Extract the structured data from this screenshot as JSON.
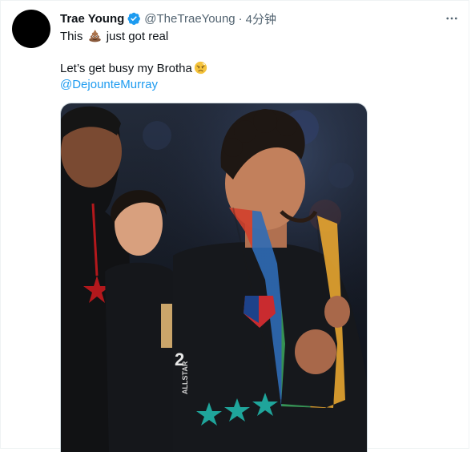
{
  "tweet": {
    "author_name": "Trae Young",
    "author_handle": "@TheTraeYoung",
    "separator": "·",
    "time": "4分钟",
    "line1_before": "This",
    "line1_after": "just got real",
    "line2": "Let’s get busy my Brotha",
    "mention": "@DejounteMurray"
  },
  "jersey": {
    "number": "2",
    "team_text": "ALLSTAR"
  },
  "icons": {
    "verified": "verified-badge-icon",
    "more": "more-options-icon",
    "poop": "poop-emoji-icon",
    "angry": "angry-face-emoji-icon"
  },
  "colors": {
    "link": "#1d9bf0",
    "secondary_text": "#536471",
    "jersey_teal": "#1fa59b"
  }
}
